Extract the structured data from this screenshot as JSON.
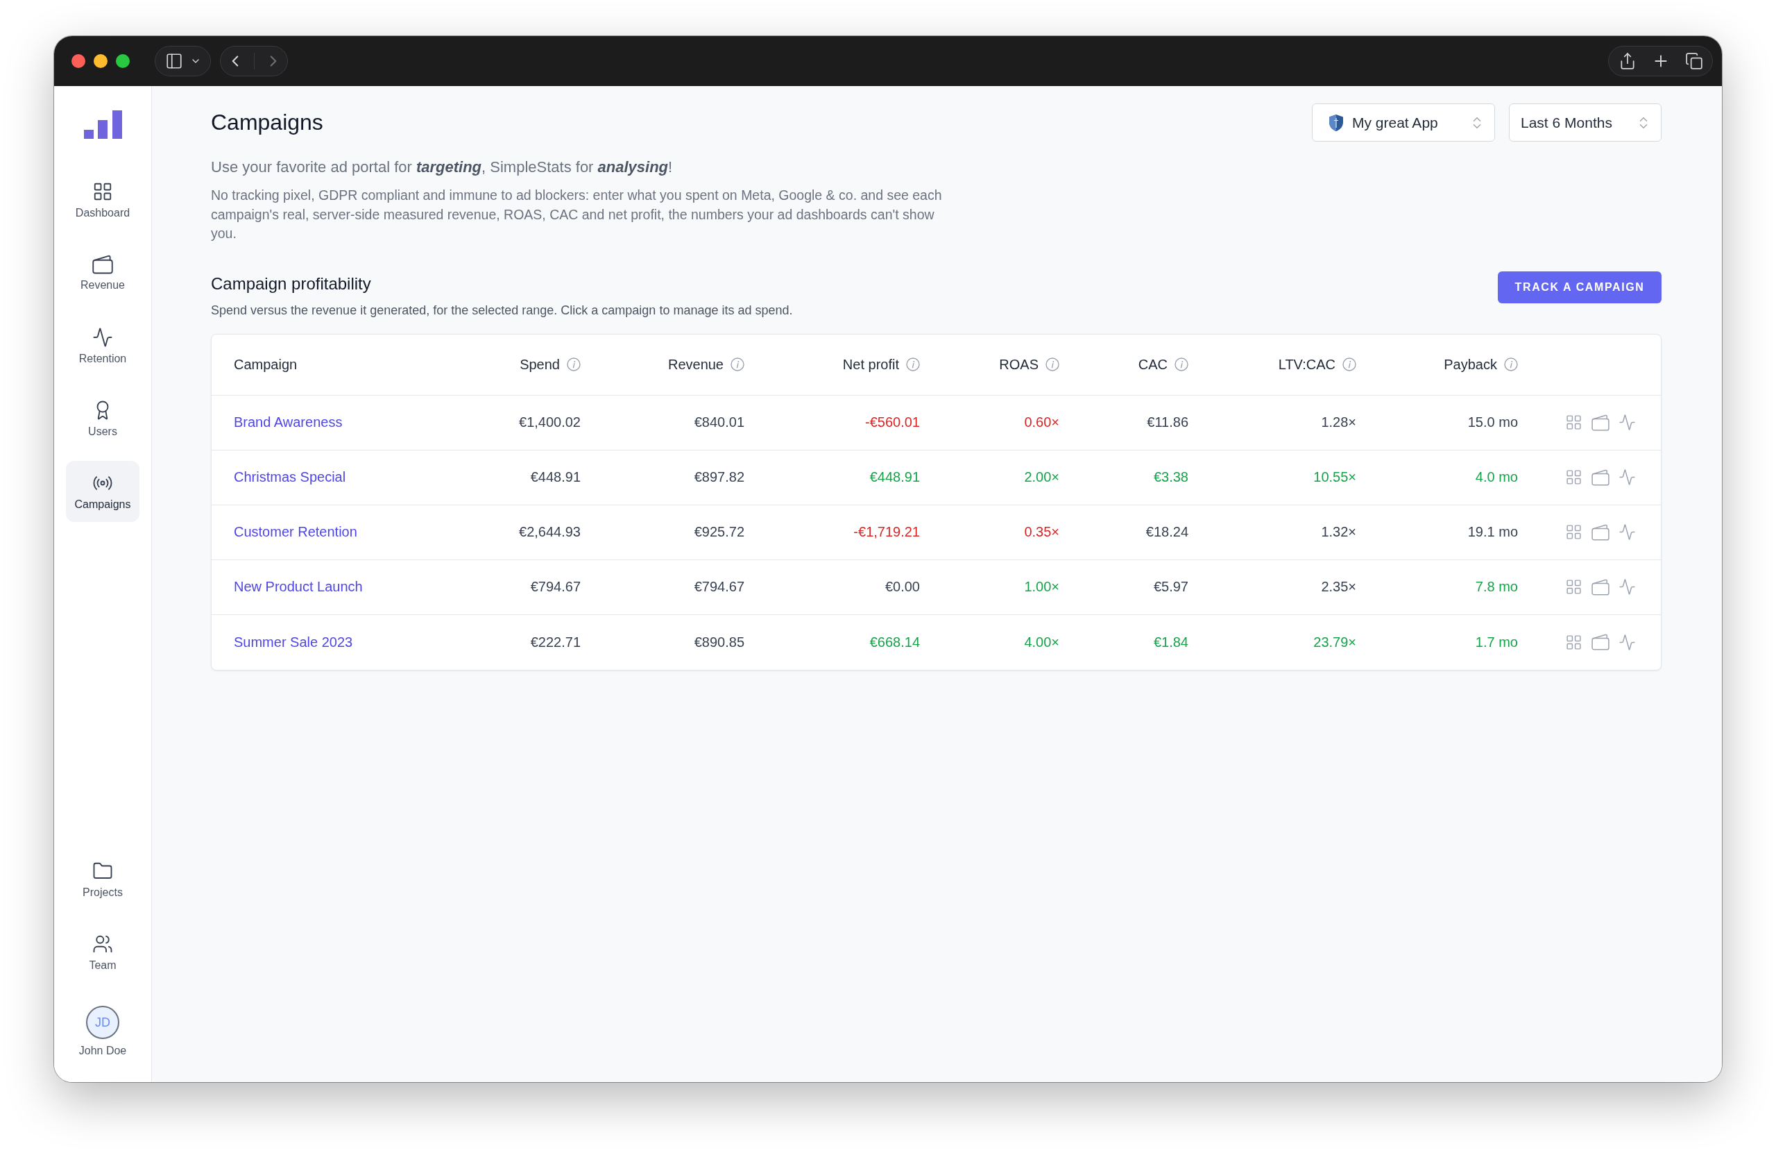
{
  "sidebar": {
    "items": [
      {
        "label": "Dashboard",
        "selected": false
      },
      {
        "label": "Revenue",
        "selected": false
      },
      {
        "label": "Retention",
        "selected": false
      },
      {
        "label": "Users",
        "selected": false
      },
      {
        "label": "Campaigns",
        "selected": true
      }
    ],
    "bottom_items": [
      {
        "label": "Projects",
        "selected": false
      },
      {
        "label": "Team",
        "selected": false
      }
    ],
    "user": {
      "initials": "JD",
      "name": "John Doe"
    }
  },
  "header": {
    "title": "Campaigns",
    "app_picker": {
      "value": "My great App"
    },
    "range_picker": {
      "value": "Last 6 Months"
    }
  },
  "intro": "Use your favorite ad portal for **targeting**, SimpleStats for **analysing**!",
  "description": "No tracking pixel, GDPR compliant and immune to ad blockers: enter what you spent on Meta, Google & co. and see each campaign's real, server-side measured revenue, ROAS, CAC and net profit, the numbers your ad dashboards can't show you.",
  "section": {
    "title": "Campaign profitability",
    "subtitle": "Spend versus the revenue it generated, for the selected range. Click a campaign to manage its ad spend.",
    "button": "TRACK A CAMPAIGN"
  },
  "table": {
    "columns": [
      {
        "label": "Campaign",
        "info": false
      },
      {
        "label": "Spend",
        "info": true
      },
      {
        "label": "Revenue",
        "info": true
      },
      {
        "label": "Net profit",
        "info": true
      },
      {
        "label": "ROAS",
        "info": true
      },
      {
        "label": "CAC",
        "info": true
      },
      {
        "label": "LTV:CAC",
        "info": true
      },
      {
        "label": "Payback",
        "info": true
      }
    ],
    "rows": [
      {
        "cells": [
          {
            "text": "Brand Awareness",
            "color": "#4f46e5"
          },
          {
            "text": "€1,400.02",
            "color": "#374151"
          },
          {
            "text": "€840.01",
            "color": "#374151"
          },
          {
            "text": "-€560.01",
            "color": "#dc2626"
          },
          {
            "text": "0.60×",
            "color": "#dc2626"
          },
          {
            "text": "€11.86",
            "color": "#374151"
          },
          {
            "text": "1.28×",
            "color": "#374151"
          },
          {
            "text": "15.0 mo",
            "color": "#374151"
          }
        ]
      },
      {
        "cells": [
          {
            "text": "Christmas Special",
            "color": "#4f46e5"
          },
          {
            "text": "€448.91",
            "color": "#374151"
          },
          {
            "text": "€897.82",
            "color": "#374151"
          },
          {
            "text": "€448.91",
            "color": "#16a34a"
          },
          {
            "text": "2.00×",
            "color": "#16a34a"
          },
          {
            "text": "€3.38",
            "color": "#16a34a"
          },
          {
            "text": "10.55×",
            "color": "#16a34a"
          },
          {
            "text": "4.0 mo",
            "color": "#16a34a"
          }
        ]
      },
      {
        "cells": [
          {
            "text": "Customer Retention",
            "color": "#4f46e5"
          },
          {
            "text": "€2,644.93",
            "color": "#374151"
          },
          {
            "text": "€925.72",
            "color": "#374151"
          },
          {
            "text": "-€1,719.21",
            "color": "#dc2626"
          },
          {
            "text": "0.35×",
            "color": "#dc2626"
          },
          {
            "text": "€18.24",
            "color": "#374151"
          },
          {
            "text": "1.32×",
            "color": "#374151"
          },
          {
            "text": "19.1 mo",
            "color": "#374151"
          }
        ]
      },
      {
        "cells": [
          {
            "text": "New Product Launch",
            "color": "#4f46e5"
          },
          {
            "text": "€794.67",
            "color": "#374151"
          },
          {
            "text": "€794.67",
            "color": "#374151"
          },
          {
            "text": "€0.00",
            "color": "#374151"
          },
          {
            "text": "1.00×",
            "color": "#16a34a"
          },
          {
            "text": "€5.97",
            "color": "#374151"
          },
          {
            "text": "2.35×",
            "color": "#374151"
          },
          {
            "text": "7.8 mo",
            "color": "#16a34a"
          }
        ]
      },
      {
        "cells": [
          {
            "text": "Summer Sale 2023",
            "color": "#4f46e5"
          },
          {
            "text": "€222.71",
            "color": "#374151"
          },
          {
            "text": "€890.85",
            "color": "#374151"
          },
          {
            "text": "€668.14",
            "color": "#16a34a"
          },
          {
            "text": "4.00×",
            "color": "#16a34a"
          },
          {
            "text": "€1.84",
            "color": "#16a34a"
          },
          {
            "text": "23.79×",
            "color": "#16a34a"
          },
          {
            "text": "1.7 mo",
            "color": "#16a34a"
          }
        ]
      }
    ]
  }
}
